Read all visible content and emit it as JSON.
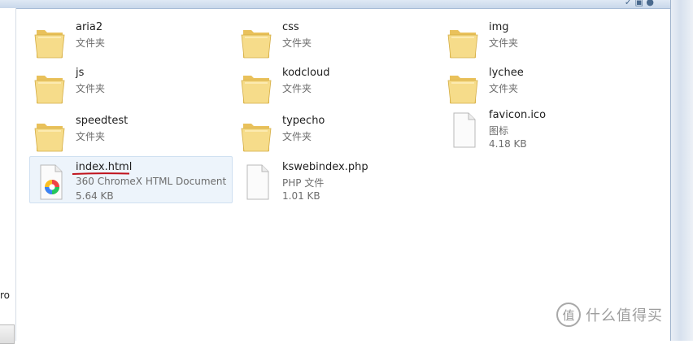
{
  "top_bar": {
    "icons": "✓ ▣ ●"
  },
  "left_pane": {
    "partial_text": "ro"
  },
  "items": [
    {
      "name": "aria2",
      "type": "文件夹",
      "kind": "folder"
    },
    {
      "name": "css",
      "type": "文件夹",
      "kind": "folder"
    },
    {
      "name": "img",
      "type": "文件夹",
      "kind": "folder"
    },
    {
      "name": "js",
      "type": "文件夹",
      "kind": "folder"
    },
    {
      "name": "kodcloud",
      "type": "文件夹",
      "kind": "folder"
    },
    {
      "name": "lychee",
      "type": "文件夹",
      "kind": "folder"
    },
    {
      "name": "speedtest",
      "type": "文件夹",
      "kind": "folder"
    },
    {
      "name": "typecho",
      "type": "文件夹",
      "kind": "folder"
    },
    {
      "name": "favicon.ico",
      "type": "图标",
      "size": "4.18 KB",
      "kind": "file"
    },
    {
      "name": "index.html",
      "type": "360 ChromeX HTML Document",
      "size": "5.64 KB",
      "kind": "html",
      "selected": true
    },
    {
      "name": "kswebindex.php",
      "type": "PHP 文件",
      "size": "1.01 KB",
      "kind": "file"
    }
  ],
  "watermark": {
    "logo": "值",
    "text": "什么值得买"
  },
  "colors": {
    "annotation_underline": "#c0121b",
    "selection_bg": "#edf4fb",
    "folder_yellow": "#f3d36f"
  }
}
